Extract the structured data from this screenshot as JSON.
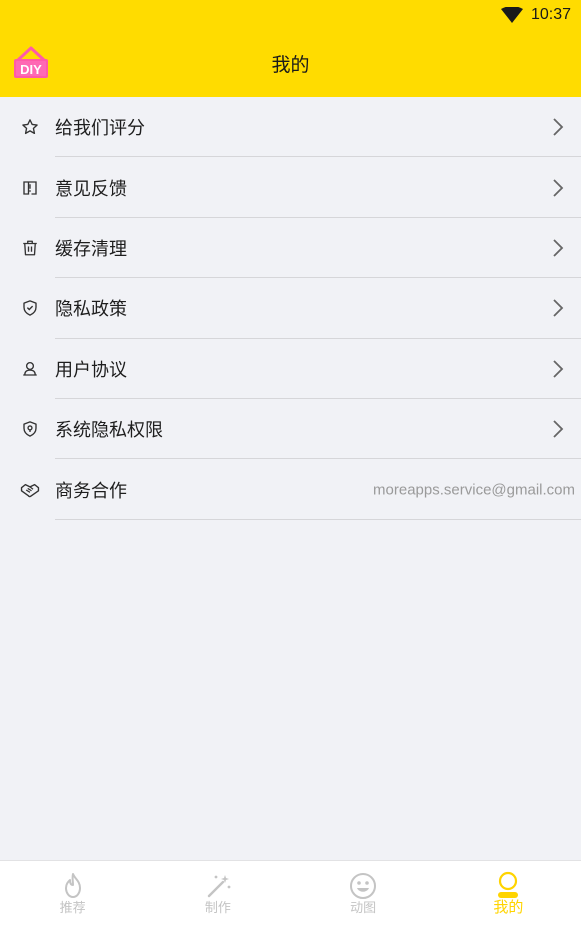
{
  "status_bar": {
    "time": "10:37",
    "wifi_icon": "wifi-icon"
  },
  "header": {
    "title": "我的",
    "logo_text": "DIY",
    "logo_icon": "diy-house-logo"
  },
  "menu": {
    "items": [
      {
        "label": "给我们评分",
        "icon": "star-icon"
      },
      {
        "label": "意见反馈",
        "icon": "feedback-icon"
      },
      {
        "label": "缓存清理",
        "icon": "trash-icon"
      },
      {
        "label": "隐私政策",
        "icon": "shield-check-icon"
      },
      {
        "label": "用户协议",
        "icon": "user-agreement-icon"
      },
      {
        "label": "系统隐私权限",
        "icon": "privacy-permission-icon"
      },
      {
        "label": "商务合作",
        "icon": "handshake-icon",
        "value": "moreapps.service@gmail.com"
      }
    ]
  },
  "tabbar": {
    "tabs": [
      {
        "label": "推荐",
        "icon": "flame-icon",
        "active": false
      },
      {
        "label": "制作",
        "icon": "magic-wand-icon",
        "active": false
      },
      {
        "label": "动图",
        "icon": "smiley-icon",
        "active": false
      },
      {
        "label": "我的",
        "icon": "profile-icon",
        "active": true
      }
    ]
  },
  "colors": {
    "header_bg": "#ffdc00",
    "page_bg": "#f1f2f6",
    "active_tab": "#ffd400",
    "inactive_tab": "#c4c4c4"
  }
}
